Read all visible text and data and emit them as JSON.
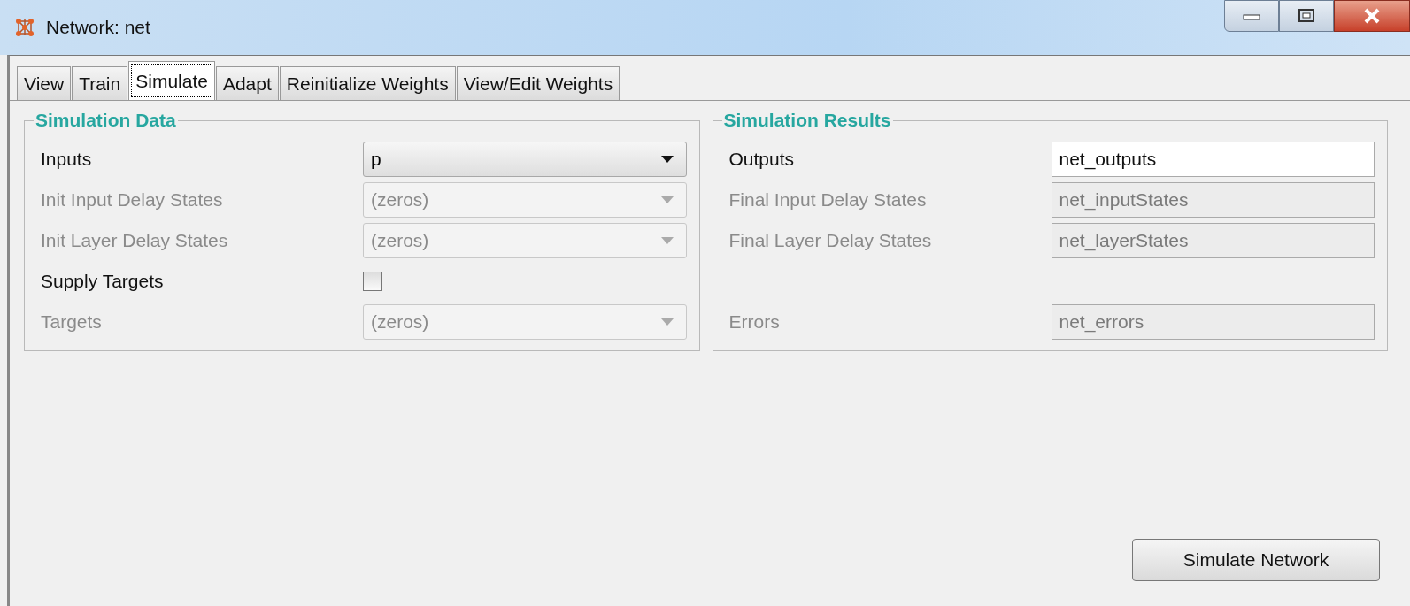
{
  "window": {
    "title": "Network: net"
  },
  "tabs": [
    {
      "label": "View",
      "selected": false
    },
    {
      "label": "Train",
      "selected": false
    },
    {
      "label": "Simulate",
      "selected": true
    },
    {
      "label": "Adapt",
      "selected": false
    },
    {
      "label": "Reinitialize Weights",
      "selected": false
    },
    {
      "label": "View/Edit Weights",
      "selected": false
    }
  ],
  "simulation_data": {
    "title": "Simulation Data",
    "rows": [
      {
        "kind": "combo",
        "label": "Inputs",
        "value": "p",
        "disabled": false
      },
      {
        "kind": "combo",
        "label": "Init Input Delay States",
        "value": "(zeros)",
        "disabled": true
      },
      {
        "kind": "combo",
        "label": "Init Layer Delay States",
        "value": "(zeros)",
        "disabled": true
      },
      {
        "kind": "checkbox",
        "label": "Supply Targets",
        "checked": false,
        "disabled": false
      },
      {
        "kind": "combo",
        "label": "Targets",
        "value": "(zeros)",
        "disabled": true
      }
    ]
  },
  "simulation_results": {
    "title": "Simulation Results",
    "rows": [
      {
        "label": "Outputs",
        "value": "net_outputs",
        "disabled": false
      },
      {
        "label": "Final Input Delay States",
        "value": "net_inputStates",
        "disabled": true
      },
      {
        "label": "Final Layer Delay States",
        "value": "net_layerStates",
        "disabled": true
      },
      {
        "label": "Errors",
        "value": "net_errors",
        "disabled": true
      }
    ]
  },
  "simulate_button": "Simulate Network"
}
